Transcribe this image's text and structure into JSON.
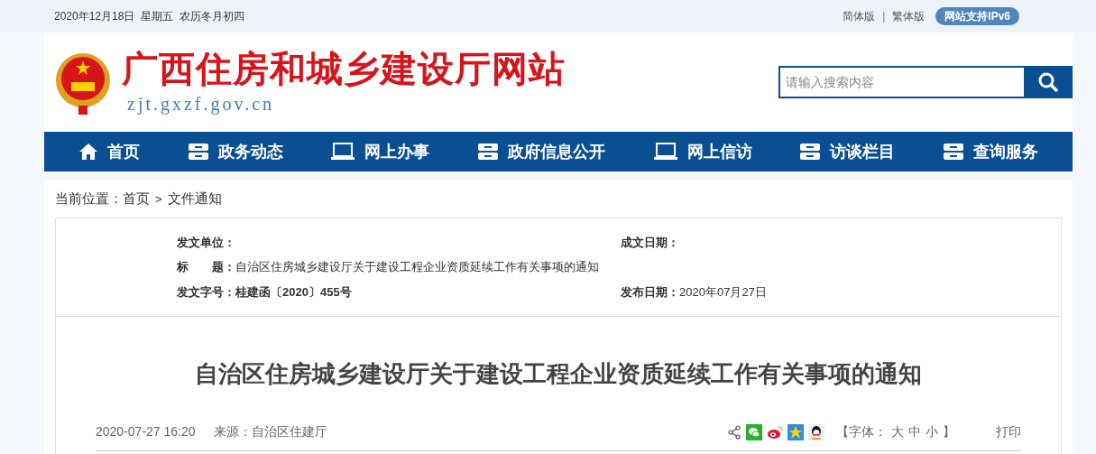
{
  "top_bar": {
    "date": "2020年12月18日  星期五  农历冬月初四",
    "links": [
      {
        "label": "简体版"
      },
      {
        "label": "繁体版"
      }
    ],
    "separator": "|",
    "badge": "网站支持IPv6"
  },
  "header": {
    "site_name": "广西住房和城乡建设厅网站",
    "domain": "zjt.gxzf.gov.cn",
    "search": {
      "placeholder": "请输入搜索内容"
    }
  },
  "nav": [
    {
      "label": "首页",
      "kind": "home"
    },
    {
      "label": "政务动态",
      "kind": "tray"
    },
    {
      "label": "网上办事",
      "kind": "laptop"
    },
    {
      "label": "政府信息公开",
      "kind": "tray"
    },
    {
      "label": "网上信访",
      "kind": "laptop"
    },
    {
      "label": "访谈栏目",
      "kind": "tray"
    },
    {
      "label": "查询服务",
      "kind": "tray"
    }
  ],
  "breadcrumb": {
    "prefix": "当前位置：",
    "items": [
      {
        "label": "首页"
      },
      {
        "label": "文件通知"
      }
    ],
    "separator": ">"
  },
  "info": [
    {
      "label": "发文单位："
    },
    {
      "label": "成文日期："
    },
    {
      "label": "标　　题：",
      "value": "自治区住房城乡建设厅关于建设工程企业资质延续工作有关事项的通知"
    },
    {
      "label": "发文字号：",
      "value": "桂建函〔2020〕455号",
      "bold": true
    },
    {
      "label": "发布日期：",
      "value": "2020年07月27日",
      "bold": false
    }
  ],
  "article": {
    "title": "自治区住房城乡建设厅关于建设工程企业资质延续工作有关事项的通知",
    "datetime": "2020-07-27 16:20",
    "source": "来源：自治区住建厅",
    "share": [
      {
        "kind": "share"
      },
      {
        "kind": "wechat"
      },
      {
        "kind": "weibo"
      },
      {
        "kind": "qzone"
      },
      {
        "kind": "qq"
      }
    ],
    "font_label_open": "【字体：",
    "font_sizes": [
      {
        "label": "大"
      },
      {
        "label": "中"
      },
      {
        "label": "小"
      }
    ],
    "font_label_close": "】",
    "print": "打印"
  }
}
